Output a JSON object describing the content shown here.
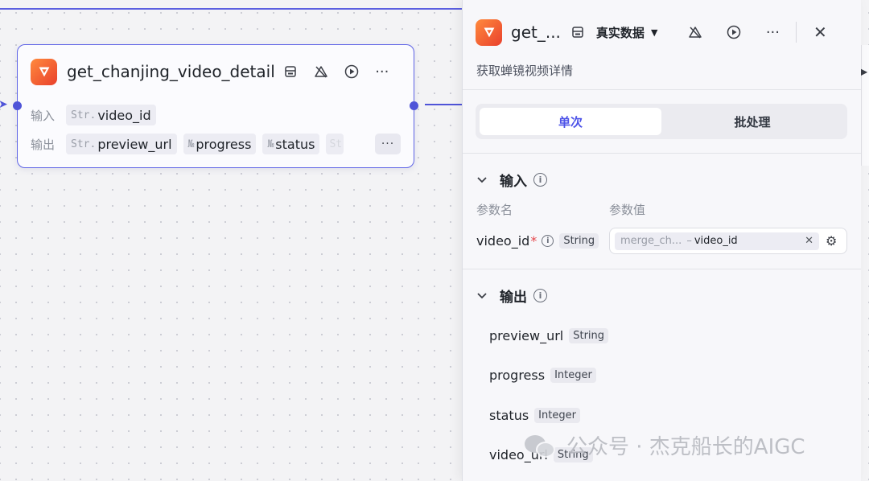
{
  "node": {
    "title": "get_chanjing_video_detail",
    "input_label": "输入",
    "output_label": "输出",
    "inputs": [
      {
        "type_abbr": "Str.",
        "name": "video_id"
      }
    ],
    "outputs": [
      {
        "type_abbr": "Str.",
        "name": "preview_url"
      },
      {
        "type_abbr": "№",
        "name": "progress"
      },
      {
        "type_abbr": "№",
        "name": "status"
      },
      {
        "type_abbr": "Str.",
        "name": ""
      }
    ],
    "more_label": "···"
  },
  "panel": {
    "title": "get_...",
    "data_mode": "真实数据",
    "description": "获取蝉镜视频详情",
    "tabs": [
      "单次",
      "批处理"
    ],
    "active_tab": "单次",
    "input_section": {
      "title": "输入",
      "col_name": "参数名",
      "col_value": "参数值",
      "param": {
        "name": "video_id",
        "required_mark": "*",
        "type": "String",
        "ref_source": "merge_ch...",
        "ref_dash": "–",
        "ref_var": "video_id"
      }
    },
    "output_section": {
      "title": "输出",
      "items": [
        {
          "name": "preview_url",
          "type": "String"
        },
        {
          "name": "progress",
          "type": "Integer"
        },
        {
          "name": "status",
          "type": "Integer"
        },
        {
          "name": "video_url",
          "type": "String"
        }
      ]
    }
  },
  "watermark": "公众号 · 杰克船长的AIGC",
  "colors": {
    "accent": "#4d53e8",
    "node_border": "#5e63e6",
    "edge": "#4f54d8",
    "logo_start": "#ff8a3d",
    "logo_end": "#e9402c"
  }
}
